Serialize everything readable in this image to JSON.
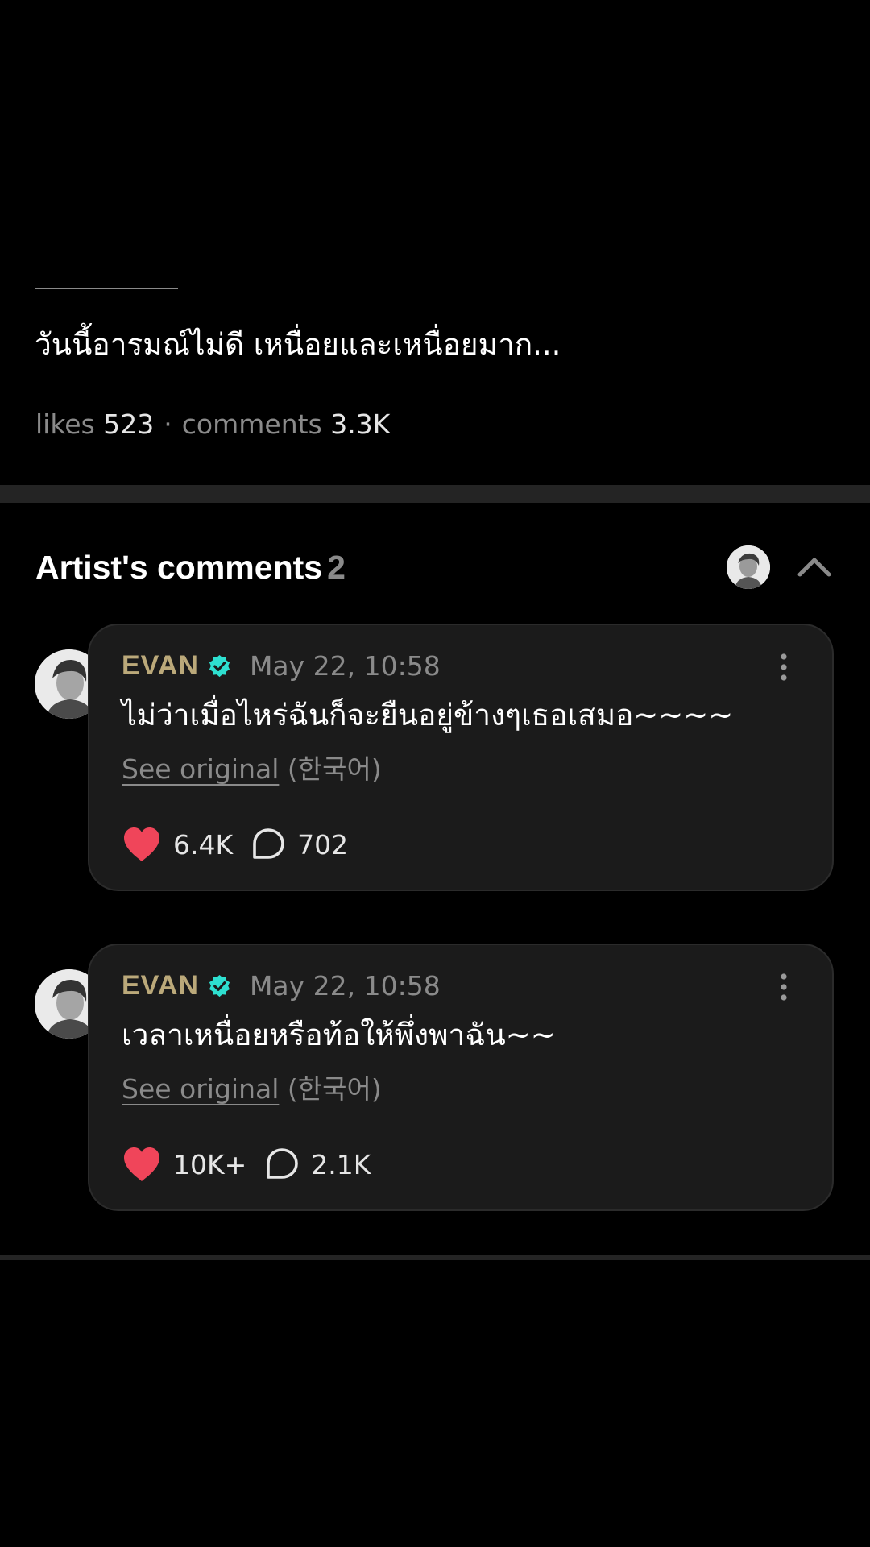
{
  "post": {
    "text": "วันนี้อารมณ์ไม่ดี เหนื่อยและเหนื่อยมาก...",
    "likes_label": "likes",
    "likes_count": "523",
    "separator": "·",
    "comments_label": "comments",
    "comments_count": "3.3K"
  },
  "artist_comments": {
    "title": "Artist's comments",
    "count": "2",
    "collapse_icon": "chevron-up-icon",
    "avatar_icon": "artist-avatar",
    "items": [
      {
        "author": "EVAN",
        "verified_icon": "verified-badge-icon",
        "timestamp": "May 22, 10:58",
        "text": "ไม่ว่าเมื่อไหร่ฉันก็จะยืนอยู่ข้างๆเธอเสมอ~~~~",
        "see_original": "See original",
        "original_language": "(한국어)",
        "likes": "6.4K",
        "replies": "702"
      },
      {
        "author": "EVAN",
        "verified_icon": "verified-badge-icon",
        "timestamp": "May 22, 10:58",
        "text": "เวลาเหนื่อยหรือท้อให้พึ่งพาฉัน~~",
        "see_original": "See original",
        "original_language": "(한국어)",
        "likes": "10K+",
        "replies": "2.1K"
      }
    ]
  },
  "colors": {
    "background": "#000000",
    "card": "#1b1b1b",
    "author": "#bba97a",
    "verified": "#2ee0d0",
    "heart": "#f0455a",
    "muted": "#8a8a8a"
  }
}
